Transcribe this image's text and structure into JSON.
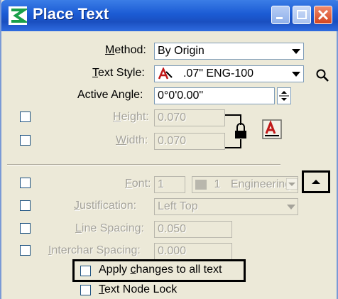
{
  "window": {
    "title": "Place Text"
  },
  "method": {
    "label_prefix": "",
    "label_underlined": "M",
    "label_rest": "ethod:",
    "value": "By Origin"
  },
  "text_style": {
    "label_underlined": "T",
    "label_rest": "ext Style:",
    "value": ".07\" ENG-100"
  },
  "active_angle": {
    "label": "Active Angle:",
    "value": "0°0'0.00\""
  },
  "height": {
    "label_underlined": "H",
    "label_rest": "eight:",
    "value": "0.070"
  },
  "width": {
    "label_underlined": "W",
    "label_rest": "idth:",
    "value": "0.070"
  },
  "font": {
    "label_underlined": "F",
    "label_rest": "ont:",
    "number": "1",
    "name_number": "1",
    "name": "Engineering"
  },
  "justification": {
    "label_underlined": "J",
    "label_rest": "ustification:",
    "value": "Left Top"
  },
  "line_spacing": {
    "label_underlined": "L",
    "label_rest": "ine Spacing:",
    "value": "0.050"
  },
  "interchar_spacing": {
    "label_underlined": "I",
    "label_rest": "nterchar Spacing:",
    "value": "0.000"
  },
  "apply_changes": {
    "label_pre": "Apply ",
    "label_underlined": "c",
    "label_rest": "hanges to all text"
  },
  "text_node_lock": {
    "label_underlined": "T",
    "label_rest": "ext Node Lock"
  },
  "icons": [
    "app-logo-icon",
    "minimize-icon",
    "maximize-icon",
    "close-icon",
    "dropdown-arrow-icon",
    "text-style-icon",
    "search-icon",
    "spin-icon",
    "lock-icon",
    "text-editor-icon",
    "collapse-arrow-icon"
  ]
}
